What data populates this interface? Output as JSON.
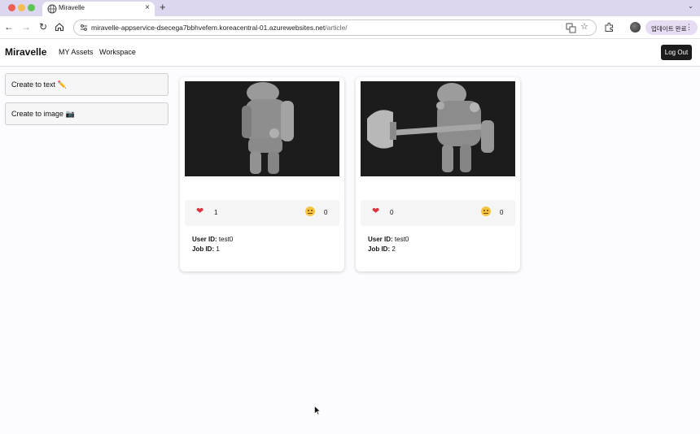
{
  "browser": {
    "tab_title": "Miravelle",
    "url_host": "miravelle-appservice-dsecega7bbhvefem.koreacentral-01.azurewebsites.net",
    "url_path": "/article/",
    "update_label": "업데이트 완료"
  },
  "app": {
    "brand": "Miravelle",
    "nav": [
      "MY Assets",
      "Workspace"
    ],
    "logout_label": "Log Out",
    "sidebar": [
      "Create to text ✏️",
      "Create to image 📷"
    ]
  },
  "cards": [
    {
      "likes": "1",
      "dislikes": "0",
      "user_label": "User ID:",
      "user_id": "test0",
      "job_label": "Job ID:",
      "job_id": "1"
    },
    {
      "likes": "0",
      "dislikes": "0",
      "user_label": "User ID:",
      "user_id": "test0",
      "job_label": "Job ID:",
      "job_id": "2"
    }
  ],
  "colors": {
    "tabbar": "#dcd6ee",
    "logout_bg": "#1c1c1c",
    "heart": "#e0303a",
    "thumb_bg": "#1c1c1c"
  },
  "icons": [
    "globe-icon",
    "close-icon",
    "plus-icon",
    "back-icon",
    "forward-icon",
    "reload-icon",
    "home-icon",
    "tune-icon",
    "translate-icon",
    "star-icon",
    "extensions-icon",
    "heart-icon",
    "sad-face-icon"
  ]
}
